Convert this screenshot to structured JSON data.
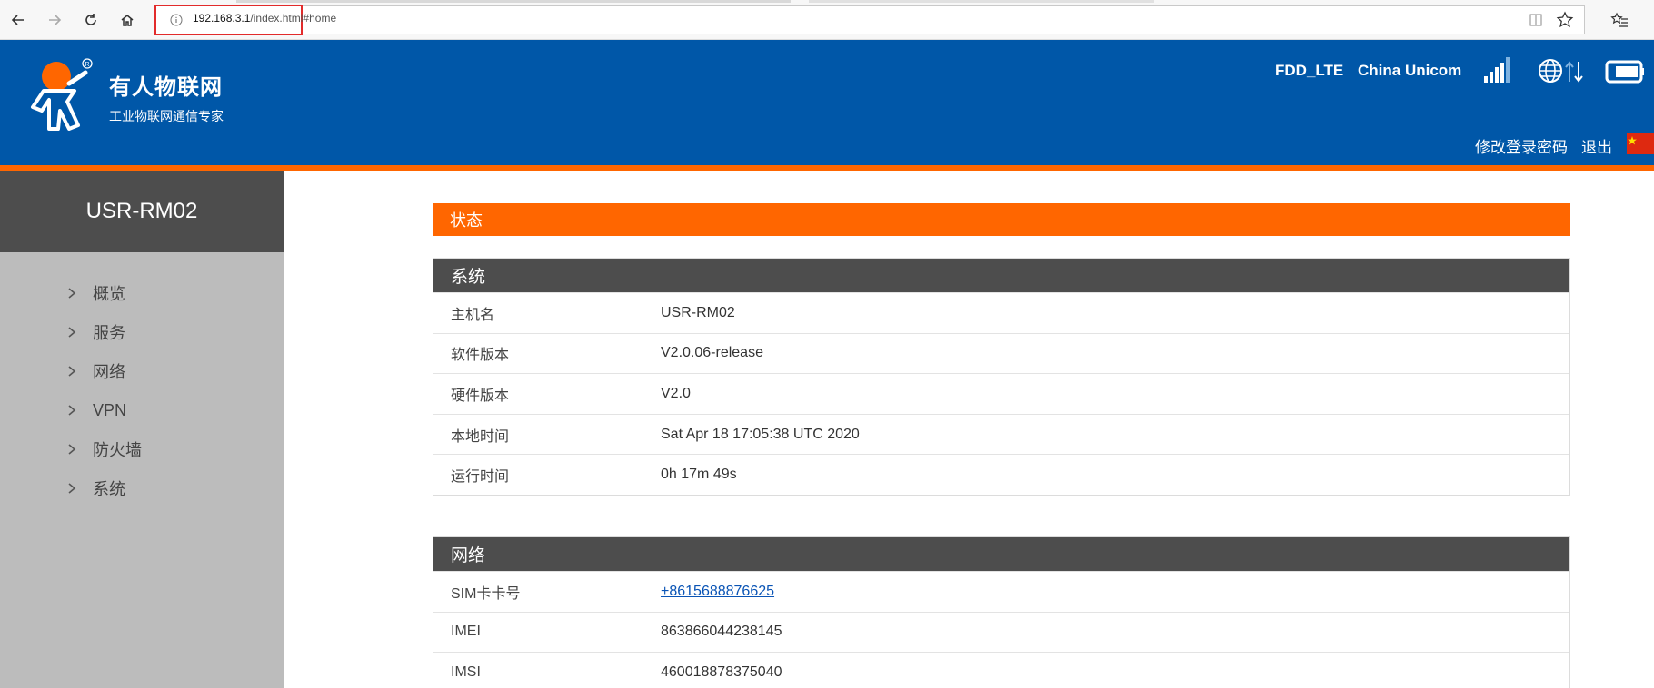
{
  "browser": {
    "url_host": "192.168.3.1",
    "url_path": "/index.html#home"
  },
  "header": {
    "brand_title": "有人物联网",
    "brand_subtitle": "工业物联网通信专家",
    "network_type": "FDD_LTE",
    "operator": "China Unicom",
    "change_password": "修改登录密码",
    "logout": "退出",
    "colors": {
      "primary": "#0057a8",
      "accent": "#ff6600"
    }
  },
  "sidebar": {
    "device_name": "USR-RM02",
    "items": [
      {
        "label": "概览"
      },
      {
        "label": "服务"
      },
      {
        "label": "网络"
      },
      {
        "label": "VPN"
      },
      {
        "label": "防火墙"
      },
      {
        "label": "系统"
      }
    ]
  },
  "main": {
    "status_title": "状态",
    "system": {
      "title": "系统",
      "rows": [
        {
          "label": "主机名",
          "value": "USR-RM02"
        },
        {
          "label": "软件版本",
          "value": "V2.0.06-release"
        },
        {
          "label": "硬件版本",
          "value": "V2.0"
        },
        {
          "label": "本地时间",
          "value": "Sat Apr 18 17:05:38 UTC 2020"
        },
        {
          "label": "运行时间",
          "value": "0h 17m 49s"
        }
      ]
    },
    "network": {
      "title": "网络",
      "rows": [
        {
          "label": "SIM卡卡号",
          "value": "+8615688876625"
        },
        {
          "label": "IMEI",
          "value": "863866044238145"
        },
        {
          "label": "IMSI",
          "value": "460018878375040"
        }
      ]
    }
  }
}
